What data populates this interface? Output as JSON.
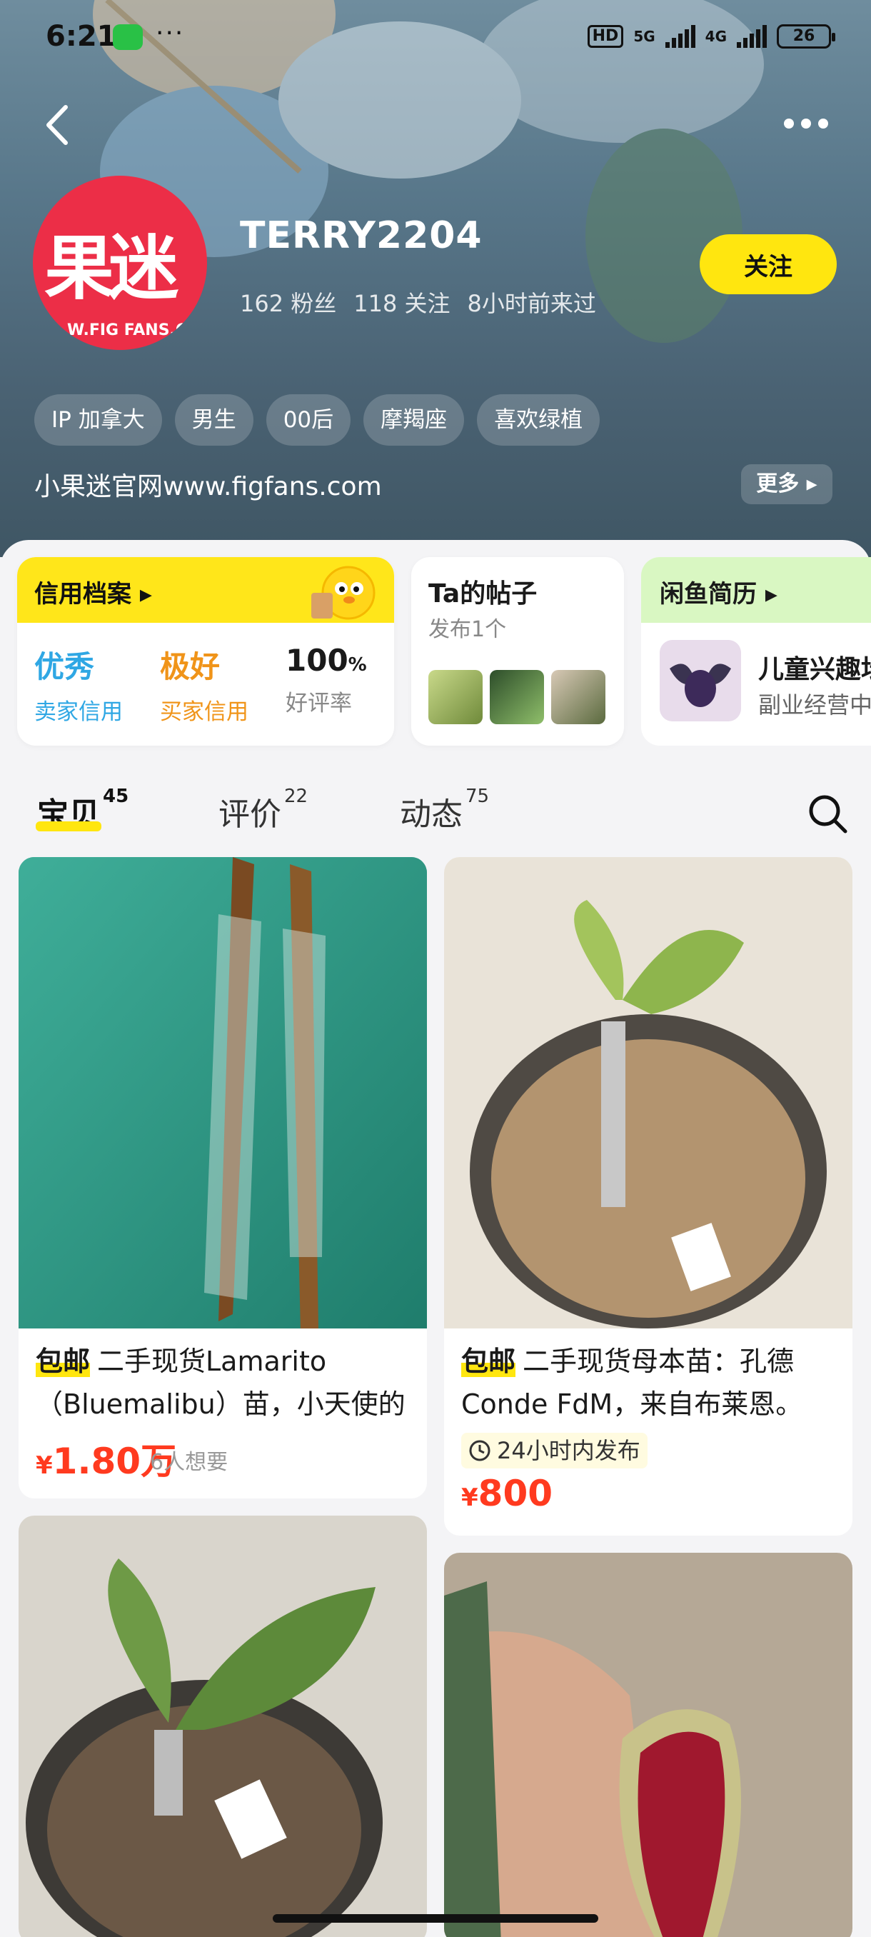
{
  "status_bar": {
    "time": "6:21",
    "dots": "···",
    "hd": "HD",
    "net_5g": "5G",
    "net_4g": "4G",
    "battery": "26"
  },
  "profile": {
    "username": "TERRY2204",
    "followers": "162 粉丝",
    "following": "118 关注",
    "last_seen": "8小时前来过",
    "follow_label": "关注",
    "avatar_text": "果迷",
    "avatar_url_text": "W.FIG FANS.C",
    "tags": [
      "IP 加拿大",
      "男生",
      "00后",
      "摩羯座",
      "喜欢绿植"
    ],
    "bio": "小果迷官网www.figfans.com",
    "bio_more": "更多"
  },
  "credit": {
    "title": "信用档案",
    "seller_value": "优秀",
    "seller_label": "卖家信用",
    "buyer_value": "极好",
    "buyer_label": "买家信用",
    "rate_value": "100",
    "rate_unit": "%",
    "rate_label": "好评率"
  },
  "posts": {
    "title": "Ta的帖子",
    "subtitle": "发布1个"
  },
  "resume": {
    "title": "闲鱼简历",
    "line1": "儿童兴趣坛",
    "line2": "副业经营中"
  },
  "tabs": [
    {
      "label": "宝贝",
      "count": "45"
    },
    {
      "label": "评价",
      "count": "22"
    },
    {
      "label": "动态",
      "count": "75"
    }
  ],
  "items": [
    {
      "badge": "包邮",
      "title": "二手现货Lamarito（Bluemalibu）苗，小天使的",
      "price_symbol": "¥",
      "price": "1.80万",
      "wants": "6人想要"
    },
    {
      "badge": "包邮",
      "title": "二手现货母本苗：孔德Conde FdM，来自布莱恩。",
      "published": "24小时内发布",
      "price_symbol": "¥",
      "price": "800"
    }
  ],
  "colors": {
    "accent_yellow": "#ffe60f",
    "price_red": "#ff3a1f",
    "seller_blue": "#2fa7e4",
    "buyer_orange": "#f09419"
  }
}
